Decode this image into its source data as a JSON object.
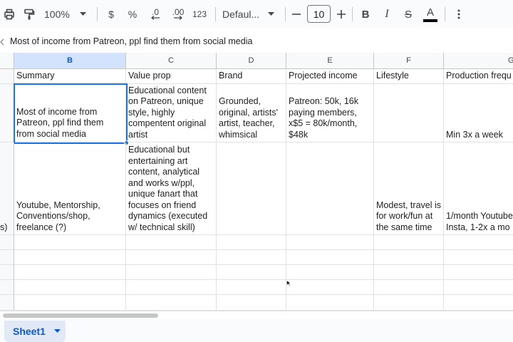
{
  "toolbar": {
    "zoom": "100%",
    "currency": "$",
    "percent": "%",
    "decrease_decimal": ".0",
    "increase_decimal": ".00",
    "number_format": "123",
    "font": "Defaul...",
    "font_size": "10",
    "bold": "B",
    "italic": "I",
    "strikethrough": "S",
    "text_color": "A",
    "text_color_value": "#000000"
  },
  "formula_bar": {
    "content": "Most of income from Patreon, ppl find them from social media"
  },
  "columns": [
    {
      "letter": "B",
      "active": true
    },
    {
      "letter": "C",
      "active": false
    },
    {
      "letter": "D",
      "active": false
    },
    {
      "letter": "E",
      "active": false
    },
    {
      "letter": "F",
      "active": false
    },
    {
      "letter": "G",
      "active": false
    }
  ],
  "rows": [
    {
      "cells": [
        "Summary",
        "Value prop",
        "Brand",
        "Projected income",
        "Lifestyle",
        "Production frequ"
      ]
    },
    {
      "cells": [
        "Most of income from Patreon, ppl find them from social media",
        "Educational content on Patreon, unique style, highly compentent original artist",
        "Grounded, original, artists' artist, teacher, whimsical",
        "Patreon: 50k, 16k paying members, x$5 = 80k/month, $48k",
        "",
        "Min 3x a week"
      ]
    },
    {
      "overflow_left": "s)",
      "cells": [
        "Youtube, Mentorship, Conventions/shop, freelance (?)",
        "Educational but entertaining art content, analytical and works w/ppl, unique fanart that focuses on friend dynamics (executed w/ technical skill)",
        "",
        "",
        "Modest, travel is for work/fun at the same time",
        "1/month Youtube\nInsta, 1-2x a mo"
      ]
    }
  ],
  "sheets": [
    {
      "name": "Sheet1",
      "active": true
    }
  ],
  "colors": {
    "accent": "#1a73e8",
    "active_header_bg": "#d3e3fd",
    "active_tab_bg": "#e1e9f7"
  }
}
